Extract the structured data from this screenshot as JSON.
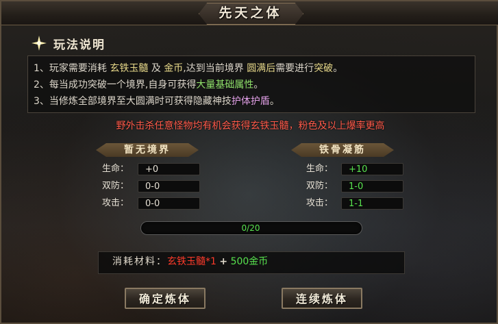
{
  "window": {
    "title": "先天之体"
  },
  "intro": {
    "title": "玩法说明",
    "rules": [
      {
        "prefix": "1、玩家需要消耗",
        "item": "玄铁玉髓",
        "mid1": "及",
        "gold": "金币",
        "mid2": ",达到当前境界",
        "full": "圆满后",
        "mid3": "需要进行",
        "breakthrough": "突破",
        "end": "。"
      },
      {
        "prefix": "2、每当成功突破一个境界,自身可获得",
        "attr": "大量基础属性",
        "end": "。"
      },
      {
        "prefix": "3、当修炼全部境界至大圆满时可获得隐藏神技",
        "shield": "护体护盾",
        "end": "。"
      }
    ],
    "drop_tip": "野外击杀任意怪物均有机会获得玄铁玉髓，粉色及以上爆率更高"
  },
  "current_realm": {
    "name": "暂无境界",
    "stats": [
      {
        "label": "生命：",
        "value": "+0"
      },
      {
        "label": "双防：",
        "value": "0-0"
      },
      {
        "label": "攻击：",
        "value": "0-0"
      }
    ]
  },
  "next_realm": {
    "name": "铁骨凝筋",
    "stats": [
      {
        "label": "生命：",
        "value": "+10"
      },
      {
        "label": "双防：",
        "value": "1-0"
      },
      {
        "label": "攻击：",
        "value": "1-1"
      }
    ]
  },
  "progress": {
    "text": "0/20",
    "current": 0,
    "max": 20
  },
  "materials": {
    "label": "消耗材料：",
    "item": "玄铁玉髓*1",
    "plus": "+",
    "gold": "500金币"
  },
  "buttons": {
    "confirm": "确定炼体",
    "continuous": "连续炼体"
  },
  "colors": {
    "highlight_yellow": "#e8d98a",
    "highlight_green": "#8fe06a",
    "highlight_pink": "#e2a0e8",
    "stat_green": "#58e34e",
    "tip_red": "#ff5a4a"
  }
}
